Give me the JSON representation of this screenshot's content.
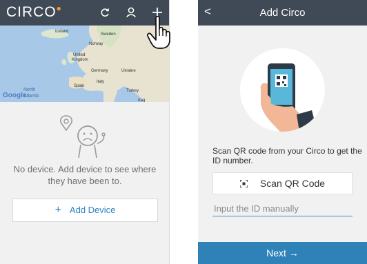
{
  "left_screen": {
    "app_name": "CIRCO",
    "toolbar_icons": [
      "refresh-icon",
      "person-icon",
      "plus-icon"
    ],
    "map": {
      "labels": [
        "Iceland",
        "Sweden",
        "Norway",
        "United Kingdom",
        "Germany",
        "Ukraine",
        "Spain",
        "Italy",
        "Turkey",
        "Iraq",
        "North",
        "Atlantic"
      ],
      "attribution": "Google"
    },
    "empty_message": "No device. Add device to see where they have been to.",
    "add_device_label": "Add Device",
    "add_device_icon": "+"
  },
  "right_screen": {
    "back_icon": "<",
    "title": "Add Circo",
    "instruction": "Scan QR code from your Circo to get the ID number.",
    "scan_button_label": "Scan QR Code",
    "id_input_placeholder": "Input the ID manually",
    "next_label": "Next →"
  },
  "colors": {
    "topbar": "#3f4a56",
    "accent": "#2f82b8",
    "link": "#2f84c3",
    "logo_accent": "#f39a2b"
  }
}
